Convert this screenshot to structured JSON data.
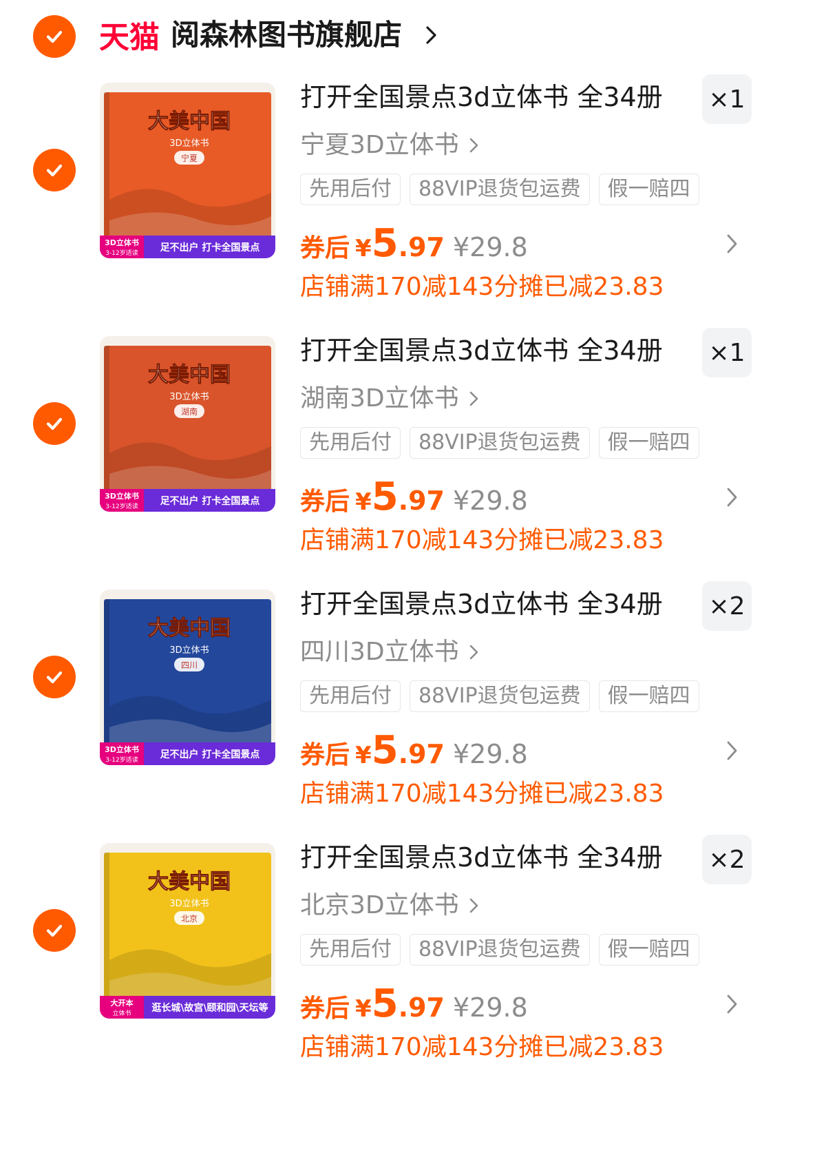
{
  "store": {
    "platform": "天猫",
    "name": "阅森林图书旗舰店",
    "accent_color": "#ff5a00",
    "selected": true
  },
  "items": [
    {
      "selected": true,
      "title": "打开全国景点3d立体书 全34册",
      "quantity": "×1",
      "sku": "宁夏3D立体书",
      "tags": [
        "先用后付",
        "88VIP退货包运费",
        "假一赔四"
      ],
      "coupon_label": "券后",
      "currency": "¥",
      "price_int": "5",
      "price_dec": ".97",
      "original_price": "¥29.8",
      "discount_note": "店铺满170减143分摊已减23.83",
      "thumb": {
        "cover_color": "#e85a26",
        "book_title": "大美中国",
        "book_subtitle": "3D立体书",
        "region": "宁夏",
        "ribbon_badge": [
          "3D立体书",
          "3-12岁适读"
        ],
        "ribbon_text": "足不出户 打卡全国景点"
      }
    },
    {
      "selected": true,
      "title": "打开全国景点3d立体书 全34册",
      "quantity": "×1",
      "sku": "湖南3D立体书",
      "tags": [
        "先用后付",
        "88VIP退货包运费",
        "假一赔四"
      ],
      "coupon_label": "券后",
      "currency": "¥",
      "price_int": "5",
      "price_dec": ".97",
      "original_price": "¥29.8",
      "discount_note": "店铺满170减143分摊已减23.83",
      "thumb": {
        "cover_color": "#d9542b",
        "book_title": "大美中国",
        "book_subtitle": "3D立体书",
        "region": "湖南",
        "ribbon_badge": [
          "3D立体书",
          "3-12岁适读"
        ],
        "ribbon_text": "足不出户 打卡全国景点"
      }
    },
    {
      "selected": true,
      "title": "打开全国景点3d立体书 全34册",
      "quantity": "×2",
      "sku": "四川3D立体书",
      "tags": [
        "先用后付",
        "88VIP退货包运费",
        "假一赔四"
      ],
      "coupon_label": "券后",
      "currency": "¥",
      "price_int": "5",
      "price_dec": ".97",
      "original_price": "¥29.8",
      "discount_note": "店铺满170减143分摊已减23.83",
      "thumb": {
        "cover_color": "#23479b",
        "book_title": "大美中国",
        "book_subtitle": "3D立体书",
        "region": "四川",
        "ribbon_badge": [
          "3D立体书",
          "3-12岁适读"
        ],
        "ribbon_text": "足不出户 打卡全国景点"
      }
    },
    {
      "selected": true,
      "title": "打开全国景点3d立体书 全34册",
      "quantity": "×2",
      "sku": "北京3D立体书",
      "tags": [
        "先用后付",
        "88VIP退货包运费",
        "假一赔四"
      ],
      "coupon_label": "券后",
      "currency": "¥",
      "price_int": "5",
      "price_dec": ".97",
      "original_price": "¥29.8",
      "discount_note": "店铺满170减143分摊已减23.83",
      "thumb": {
        "cover_color": "#f2c21b",
        "book_title": "大美中国",
        "book_subtitle": "3D立体书",
        "region": "北京",
        "ribbon_badge": [
          "大开本",
          "立体书"
        ],
        "ribbon_text": "逛长城\\故宫\\颐和园\\天坛等"
      }
    }
  ]
}
